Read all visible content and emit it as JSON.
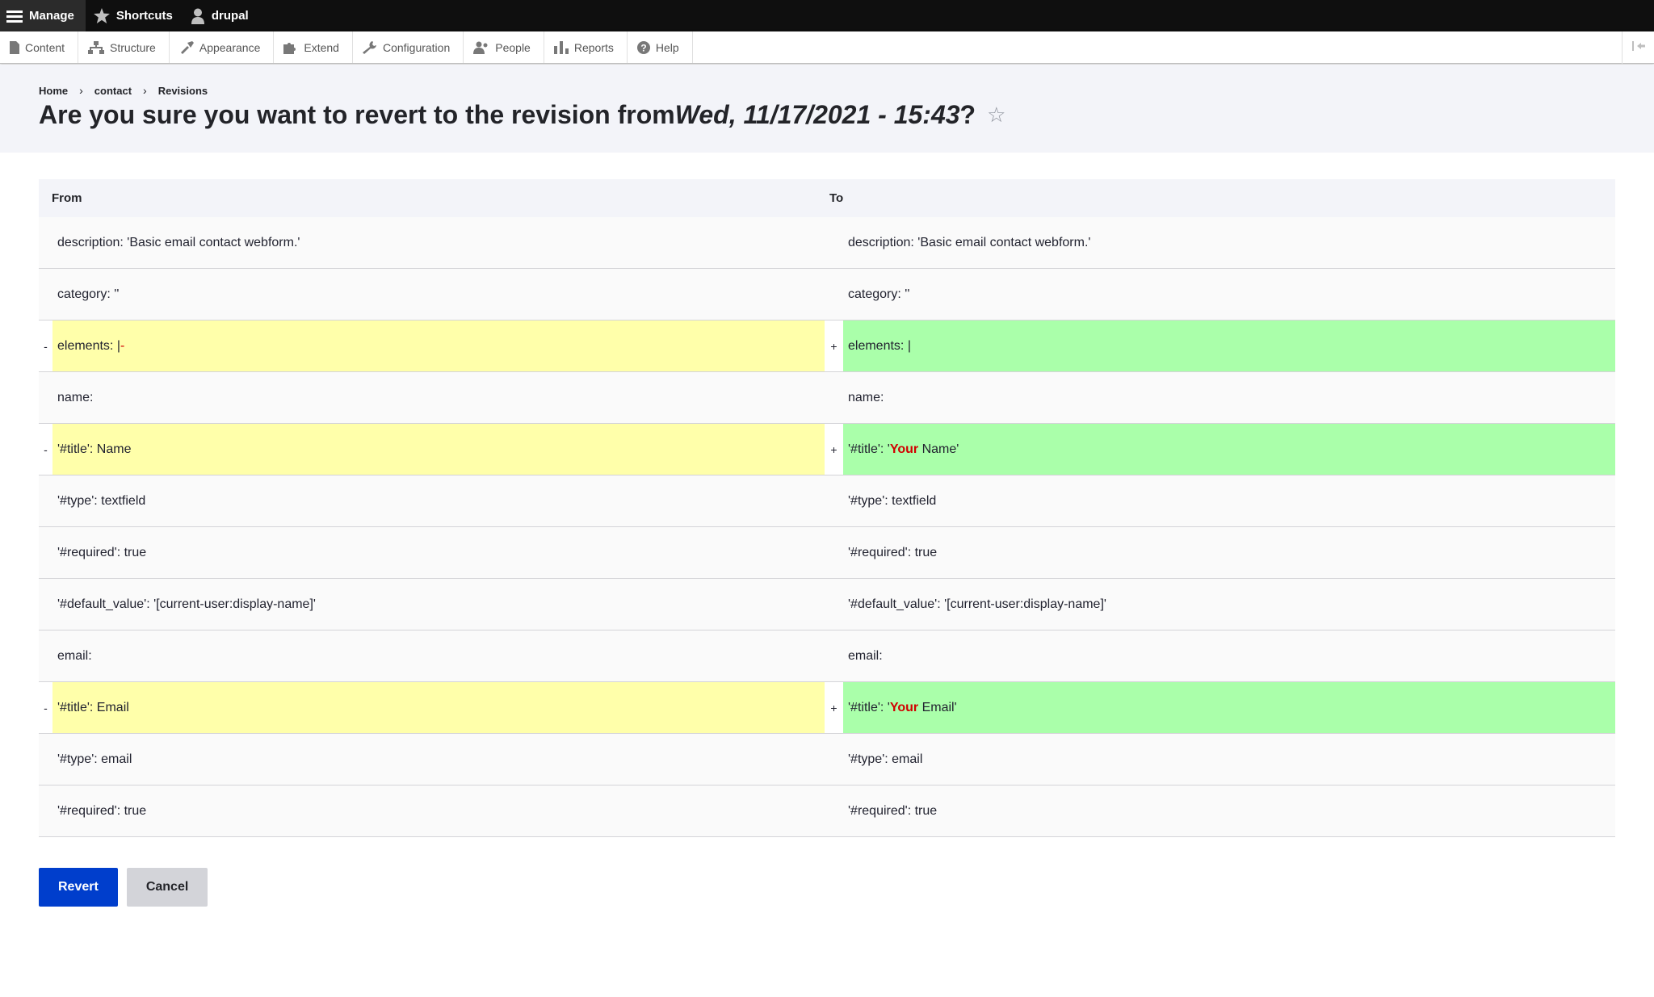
{
  "toolbar": {
    "manage": "Manage",
    "shortcuts": "Shortcuts",
    "user": "drupal"
  },
  "tray": [
    {
      "label": "Content",
      "icon": "file-icon"
    },
    {
      "label": "Structure",
      "icon": "sitemap-icon"
    },
    {
      "label": "Appearance",
      "icon": "paintbrush-icon"
    },
    {
      "label": "Extend",
      "icon": "puzzle-icon"
    },
    {
      "label": "Configuration",
      "icon": "wrench-icon"
    },
    {
      "label": "People",
      "icon": "people-icon"
    },
    {
      "label": "Reports",
      "icon": "bar-chart-icon"
    },
    {
      "label": "Help",
      "icon": "help-icon"
    }
  ],
  "breadcrumb": [
    "Home",
    "contact",
    "Revisions"
  ],
  "title": {
    "prefix": "Are you sure you want to revert to the revision from ",
    "date": "Wed, 11/17/2021 - 15:43",
    "suffix": "?",
    "star": "☆"
  },
  "diff": {
    "from_label": "From",
    "to_label": "To",
    "rows": [
      {
        "changed": false,
        "left": "description: 'Basic email contact webform.'",
        "right": "description: 'Basic email contact webform.'"
      },
      {
        "changed": false,
        "left": "category: ''",
        "right": "category: ''"
      },
      {
        "changed": true,
        "left_marker": "-",
        "right_marker": "+",
        "left_pre": "elements: |",
        "left_hl": "-",
        "left_post": "",
        "right_pre": "elements: |",
        "right_hl": "",
        "right_post": ""
      },
      {
        "changed": false,
        "left": "name:",
        "right": "name:"
      },
      {
        "changed": true,
        "left_marker": "-",
        "right_marker": "+",
        "left_pre": "'#title': Name",
        "left_hl": "",
        "left_post": "",
        "right_pre": "'#title': '",
        "right_hl": "Your",
        "right_post": " Name'"
      },
      {
        "changed": false,
        "left": "'#type': textfield",
        "right": "'#type': textfield"
      },
      {
        "changed": false,
        "left": "'#required': true",
        "right": "'#required': true"
      },
      {
        "changed": false,
        "left": "'#default_value': '[current-user:display-name]'",
        "right": "'#default_value': '[current-user:display-name]'"
      },
      {
        "changed": false,
        "left": "email:",
        "right": "email:"
      },
      {
        "changed": true,
        "left_marker": "-",
        "right_marker": "+",
        "left_pre": "'#title': Email",
        "left_hl": "",
        "left_post": "",
        "right_pre": "'#title': '",
        "right_hl": "Your",
        "right_post": " Email'"
      },
      {
        "changed": false,
        "left": "'#type': email",
        "right": "'#type': email"
      },
      {
        "changed": false,
        "left": "'#required': true",
        "right": "'#required': true"
      }
    ]
  },
  "actions": {
    "revert": "Revert",
    "cancel": "Cancel"
  },
  "colors": {
    "primary_button": "#003ecc",
    "deleted_line": "#ffffaa",
    "added_line": "#aaffaa",
    "diff_highlight": "#d10000"
  }
}
